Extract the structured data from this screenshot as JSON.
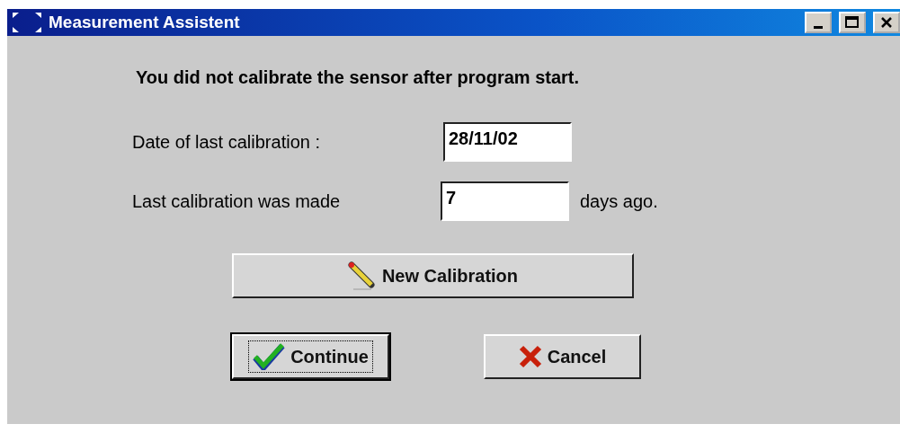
{
  "window": {
    "title": "Measurement Assistent",
    "controls": [
      {
        "kind": "minimize"
      },
      {
        "kind": "maximize"
      },
      {
        "kind": "close"
      }
    ]
  },
  "message": "You did not calibrate the sensor after program start.",
  "fields": [
    {
      "label": "Date of last calibration :",
      "value": "28/11/02"
    },
    {
      "label": "Last calibration was made",
      "value": "7",
      "suffix": "days ago."
    }
  ],
  "buttons": [
    {
      "kind": "pencil",
      "label": "New Calibration",
      "default": false
    },
    {
      "kind": "check",
      "label": "Continue",
      "default": true
    },
    {
      "kind": "cross",
      "label": "Cancel",
      "default": false
    }
  ]
}
